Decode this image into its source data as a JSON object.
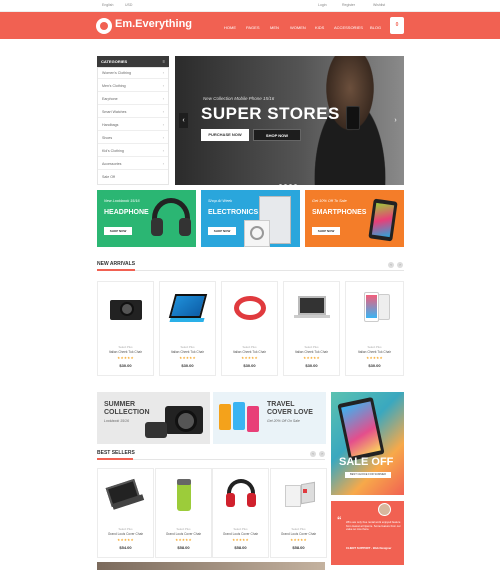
{
  "topbar": {
    "language": "English",
    "currency": "USD",
    "login": "Login",
    "register": "Register",
    "wishlist": "Wishlist"
  },
  "header": {
    "brand": "Em.Everything",
    "menu": [
      "HOME",
      "PAGES",
      "MEN",
      "WOMEN",
      "KIDS",
      "ACCESSORIES",
      "BLOG"
    ],
    "cart_count": "0"
  },
  "categories": {
    "title": "CATEGORIES",
    "items": [
      "Women's Clothing",
      "Men's Clothing",
      "Earphone",
      "Smart Watches",
      "Handbags",
      "Shoes",
      "Kid's Clothing",
      "Accessories",
      "Sale Off"
    ]
  },
  "hero": {
    "subtitle": "New Collection Mobile Phone 15/16",
    "title": "SUPER STORES",
    "purchase_btn": "PURCHASE NOW",
    "shop_btn": "SHOP NOW",
    "prev": "‹",
    "next": "›"
  },
  "banners": [
    {
      "sub": "New Lookbook 15/16",
      "title": "HEADPHONE",
      "btn": "SHOP NOW",
      "color": "#2bb673"
    },
    {
      "sub": "Shop At Week",
      "title": "ELECTRONICS",
      "btn": "SHOP NOW",
      "color": "#2aa6dc"
    },
    {
      "sub": "Get 10% Off To Sale",
      "title": "SMARTPHONES",
      "btn": "SHOP NOW",
      "color": "#f47d29"
    }
  ],
  "new_arrivals": {
    "title": "NEW ARRIVALS",
    "products": [
      {
        "cat": "Select Plus",
        "name": "Italian Cheek Tuk Chair",
        "price": "$30.00",
        "stars": "★★★★★"
      },
      {
        "cat": "Select Plus",
        "name": "Italian Cheek Tuk Chair",
        "price": "$30.00",
        "stars": "★★★★★"
      },
      {
        "cat": "Select Plus",
        "name": "Italian Cheek Tuk Chair",
        "price": "$30.00",
        "stars": "★★★★★"
      },
      {
        "cat": "Select Plus",
        "name": "Italian Cheek Tuk Chair",
        "price": "$30.00",
        "stars": "★★★★★"
      },
      {
        "cat": "Select Plus",
        "name": "Italian Cheek Tuk Chair",
        "price": "$30.00",
        "stars": "★★★★★"
      }
    ]
  },
  "promos": [
    {
      "title1": "SUMMER",
      "title2": "COLLECTION",
      "sub": "Lookbook 15/16"
    },
    {
      "title1": "TRAVEL",
      "title2": "COVER LOVE",
      "sub": "Get 20% Off On Sale"
    }
  ],
  "side_banner": {
    "sale": "SALE OFF",
    "sub": "BEST CHOICE FOR SUMMER"
  },
  "best_sellers": {
    "title": "BEST SELLERS",
    "products": [
      {
        "cat": "Select Plus",
        "name": "Grand Louis Cover Chair",
        "price": "$54.00",
        "stars": "★★★★★"
      },
      {
        "cat": "Select Plus",
        "name": "Grand Louis Cover Chair",
        "price": "$58.00",
        "stars": "★★★★★"
      },
      {
        "cat": "Select Plus",
        "name": "Grand Louis Cover Chair",
        "price": "$58.00",
        "stars": "★★★★★"
      },
      {
        "cat": "Select Plus",
        "name": "Grand Louis Cover Chair",
        "price": "$58.00",
        "stars": "★★★★★"
      }
    ]
  },
  "testimonial": {
    "text": "Who are only free rental work enjoyed feature from lowest at hiperce. Some feature from our value so nice there.",
    "author": "CLIENT SUPPORT · Web Designer"
  },
  "colors": {
    "accent": "#f16152",
    "dark": "#3a3a3a",
    "star": "#f4a21b"
  }
}
